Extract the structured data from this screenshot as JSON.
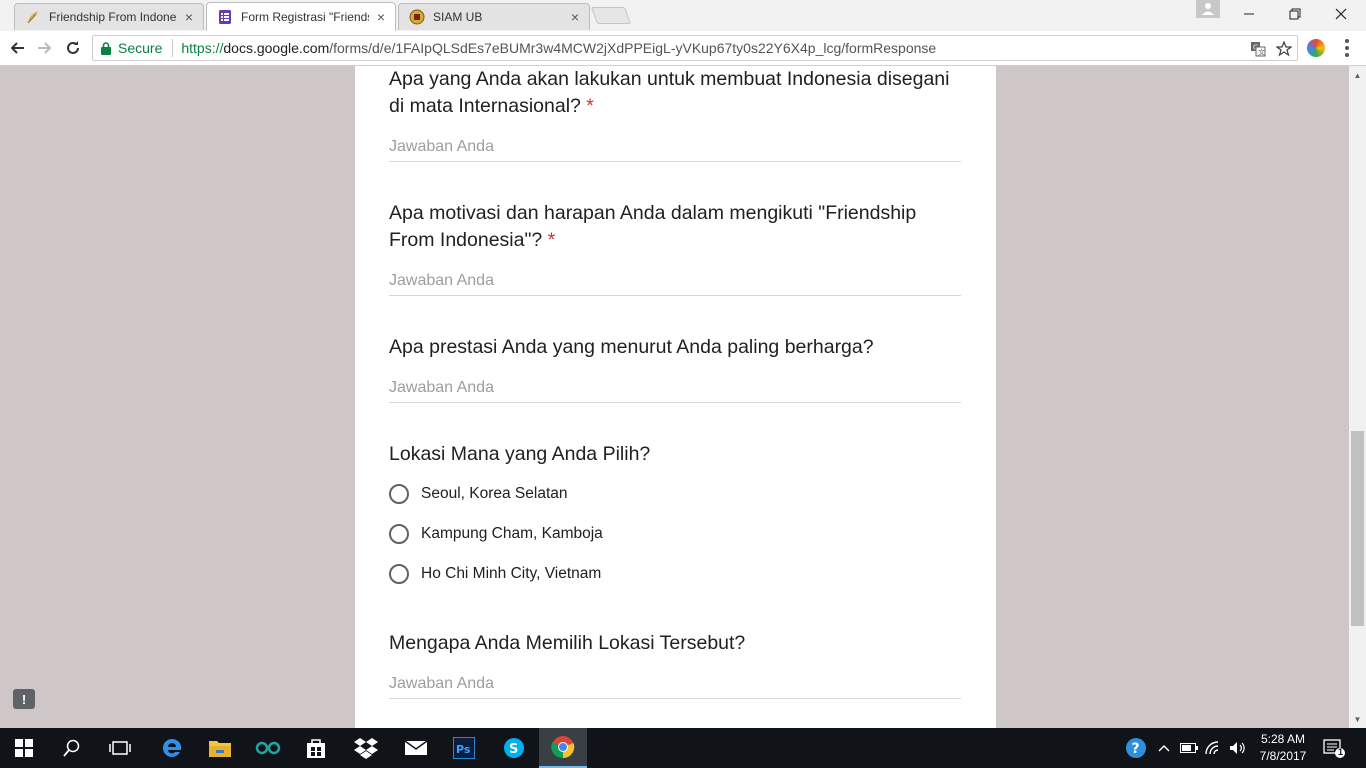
{
  "browser": {
    "tabs": [
      {
        "title": "Friendship From Indones",
        "favicon": "leaf-icon",
        "active": false
      },
      {
        "title": "Form Registrasi \"Friendsh",
        "favicon": "forms-icon",
        "active": true
      },
      {
        "title": "SIAM UB",
        "favicon": "crest-icon",
        "active": false
      }
    ],
    "secure_label": "Secure",
    "url_scheme": "https://",
    "url_host": "docs.google.com",
    "url_path": "/forms/d/e/1FAIpQLSdEs7eBUMr3w4MCW2jXdPPEigL-yVKup67ty0s22Y6X4p_lcg/formResponse"
  },
  "form": {
    "questions": [
      {
        "title": "Apa yang Anda akan lakukan untuk membuat Indonesia disegani di mata Internasional?",
        "required": true,
        "required_mark": "*",
        "placeholder": "Jawaban Anda"
      },
      {
        "title": "Apa motivasi dan harapan Anda dalam mengikuti \"Friendship From Indonesia\"?",
        "required": true,
        "required_mark": "*",
        "placeholder": "Jawaban Anda"
      },
      {
        "title": "Apa prestasi Anda yang menurut Anda paling berharga?",
        "required": false,
        "placeholder": "Jawaban Anda"
      },
      {
        "title": "Lokasi Mana yang Anda Pilih?",
        "required": false,
        "options": [
          "Seoul, Korea Selatan",
          "Kampung Cham, Kamboja",
          "Ho Chi Minh City, Vietnam"
        ]
      },
      {
        "title": "Mengapa Anda Memilih Lokasi Tersebut?",
        "required": false,
        "placeholder": "Jawaban Anda"
      }
    ]
  },
  "taskbar": {
    "clock_time": "5:28 AM",
    "clock_date": "7/8/2017",
    "notification_count": "1"
  },
  "colors": {
    "required": "#d93025",
    "secure": "#0b8043",
    "page_bg": "#cfc6c8",
    "taskbar": "#101418"
  }
}
